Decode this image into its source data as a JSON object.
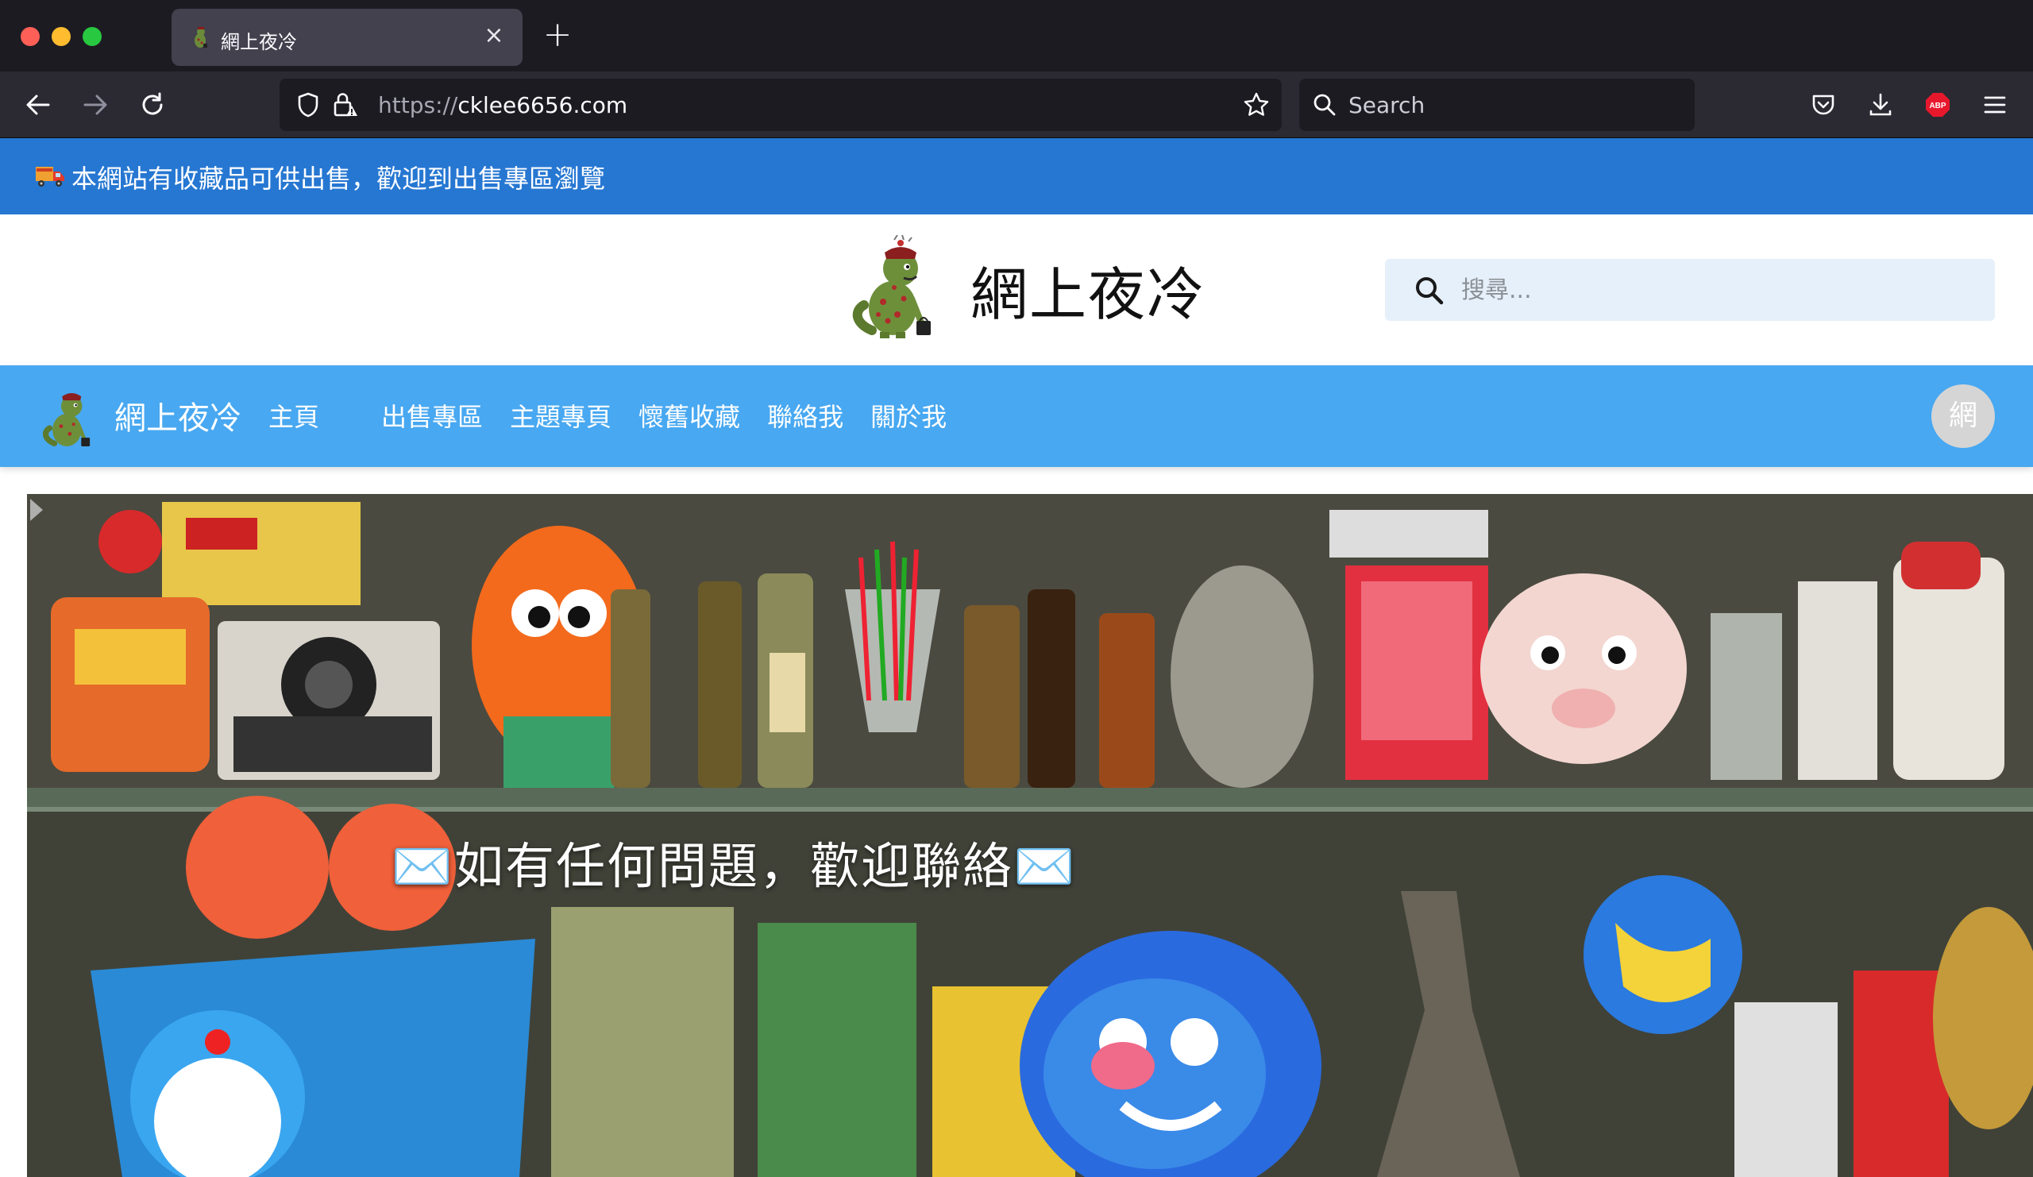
{
  "browser": {
    "tab_title": "網上夜冷",
    "tab_close": "×",
    "new_tab": "+",
    "url_scheme": "https://",
    "url_host": "cklee6656.com",
    "search_placeholder": "Search",
    "abp_label": "ABP"
  },
  "announcement": {
    "text": "本網站有收藏品可供出售，歡迎到出售專區瀏覽",
    "icon": "truck-icon"
  },
  "header": {
    "title": "網上夜冷",
    "search_placeholder": "搜尋..."
  },
  "nav": {
    "brand": "網上夜冷",
    "items": [
      {
        "label": "主頁"
      },
      {
        "label": "出售專區"
      },
      {
        "label": "主題專頁"
      },
      {
        "label": "懷舊收藏"
      },
      {
        "label": "聯絡我"
      },
      {
        "label": "關於我"
      }
    ],
    "avatar_letter": "網"
  },
  "hero": {
    "caption": "✉️如有任何問題，歡迎聯絡✉️"
  },
  "colors": {
    "announce_bg": "#2677d2",
    "nav_bg": "#48a8f1",
    "search_bg": "#e6f0fa",
    "browser_dark": "#1c1b22"
  }
}
